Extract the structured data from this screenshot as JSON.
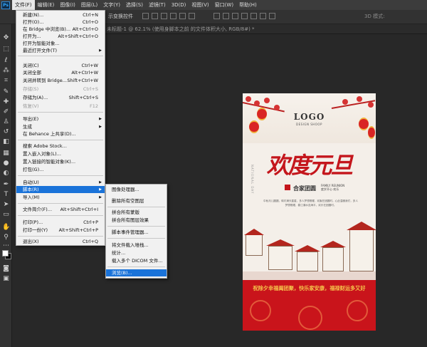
{
  "menubar": {
    "logo": "Ps",
    "items": [
      "文件(F)",
      "编辑(E)",
      "图像(I)",
      "图层(L)",
      "文字(Y)",
      "选择(S)",
      "滤镜(T)",
      "3D(D)",
      "视图(V)",
      "窗口(W)",
      "帮助(H)"
    ]
  },
  "optionsbar": {
    "ctrl_label": "示变换控件",
    "label_3d": "3D 模式:"
  },
  "document": {
    "tab_title": "未标题-1 @ 62.1% (使用身脚本之前 的文件体积大小, RGB/8#) *"
  },
  "file_menu": {
    "items": [
      {
        "label": "新建(N)...",
        "shortcut": "Ctrl+N"
      },
      {
        "label": "打开(O)...",
        "shortcut": "Ctrl+O"
      },
      {
        "label": "在 Bridge 中浏览(B)...",
        "shortcut": "Alt+Ctrl+O"
      },
      {
        "label": "打开为...",
        "shortcut": "Alt+Shift+Ctrl+O"
      },
      {
        "label": "打开为智能对象..."
      },
      {
        "label": "最近打开文件(T)",
        "submenu": true
      },
      {
        "label": "关闭(C)",
        "shortcut": "Ctrl+W"
      },
      {
        "label": "关闭全部",
        "shortcut": "Alt+Ctrl+W"
      },
      {
        "label": "关闭并转到 Bridge...",
        "shortcut": "Shift+Ctrl+W"
      },
      {
        "label": "存储(S)",
        "shortcut": "Ctrl+S",
        "disabled": true
      },
      {
        "label": "存储为(A)...",
        "shortcut": "Shift+Ctrl+S"
      },
      {
        "label": "恢复(V)",
        "shortcut": "F12",
        "disabled": true
      },
      {
        "label": "导出(E)",
        "submenu": true
      },
      {
        "label": "生成",
        "submenu": true
      },
      {
        "label": "在 Behance 上共享(D)..."
      },
      {
        "label": "搜索 Adobe Stock..."
      },
      {
        "label": "置入嵌入对象(L)..."
      },
      {
        "label": "置入链接的智能对象(K)..."
      },
      {
        "label": "打包(G)..."
      },
      {
        "label": "自动(U)",
        "submenu": true
      },
      {
        "label": "脚本(R)",
        "submenu": true,
        "highlighted": true
      },
      {
        "label": "导入(M)",
        "submenu": true
      },
      {
        "label": "文件简介(F)...",
        "shortcut": "Alt+Shift+Ctrl+I"
      },
      {
        "label": "打印(P)...",
        "shortcut": "Ctrl+P"
      },
      {
        "label": "打印一份(Y)",
        "shortcut": "Alt+Shift+Ctrl+P"
      },
      {
        "label": "退出(X)",
        "shortcut": "Ctrl+Q"
      }
    ]
  },
  "scripts_submenu": {
    "items": [
      {
        "label": "图像处理器..."
      },
      {
        "label": "删除所有空图层"
      },
      {
        "label": "拼合所有蒙版"
      },
      {
        "label": "拼合所有图层效果"
      },
      {
        "label": "脚本事件管理器..."
      },
      {
        "label": "将文件载入堆栈..."
      },
      {
        "label": "统计..."
      },
      {
        "label": "载入多个 DICOM 文件..."
      },
      {
        "label": "浏览(B)...",
        "highlighted": true
      }
    ]
  },
  "poster": {
    "logo": "LOGO",
    "logo_sub": "DESIGN SHOOP",
    "headline": "欢度元旦",
    "vertical_text": "NATIONAL DAY",
    "subtitle_cn": "合家团圆",
    "subtitle_en": "FAMILY REUNION\n度岁开心 欢乐",
    "blurb": "中秋月儿圆圆，映衬满天星星，多人梦想照耀，欢聚在团圆时。心此温暖我们，多人梦想照耀，春江潮水连海平，欢乐在团圆时。",
    "banner_text": "祝除夕幸福阖团聚，快乐家安康，福禄财运多又好"
  }
}
